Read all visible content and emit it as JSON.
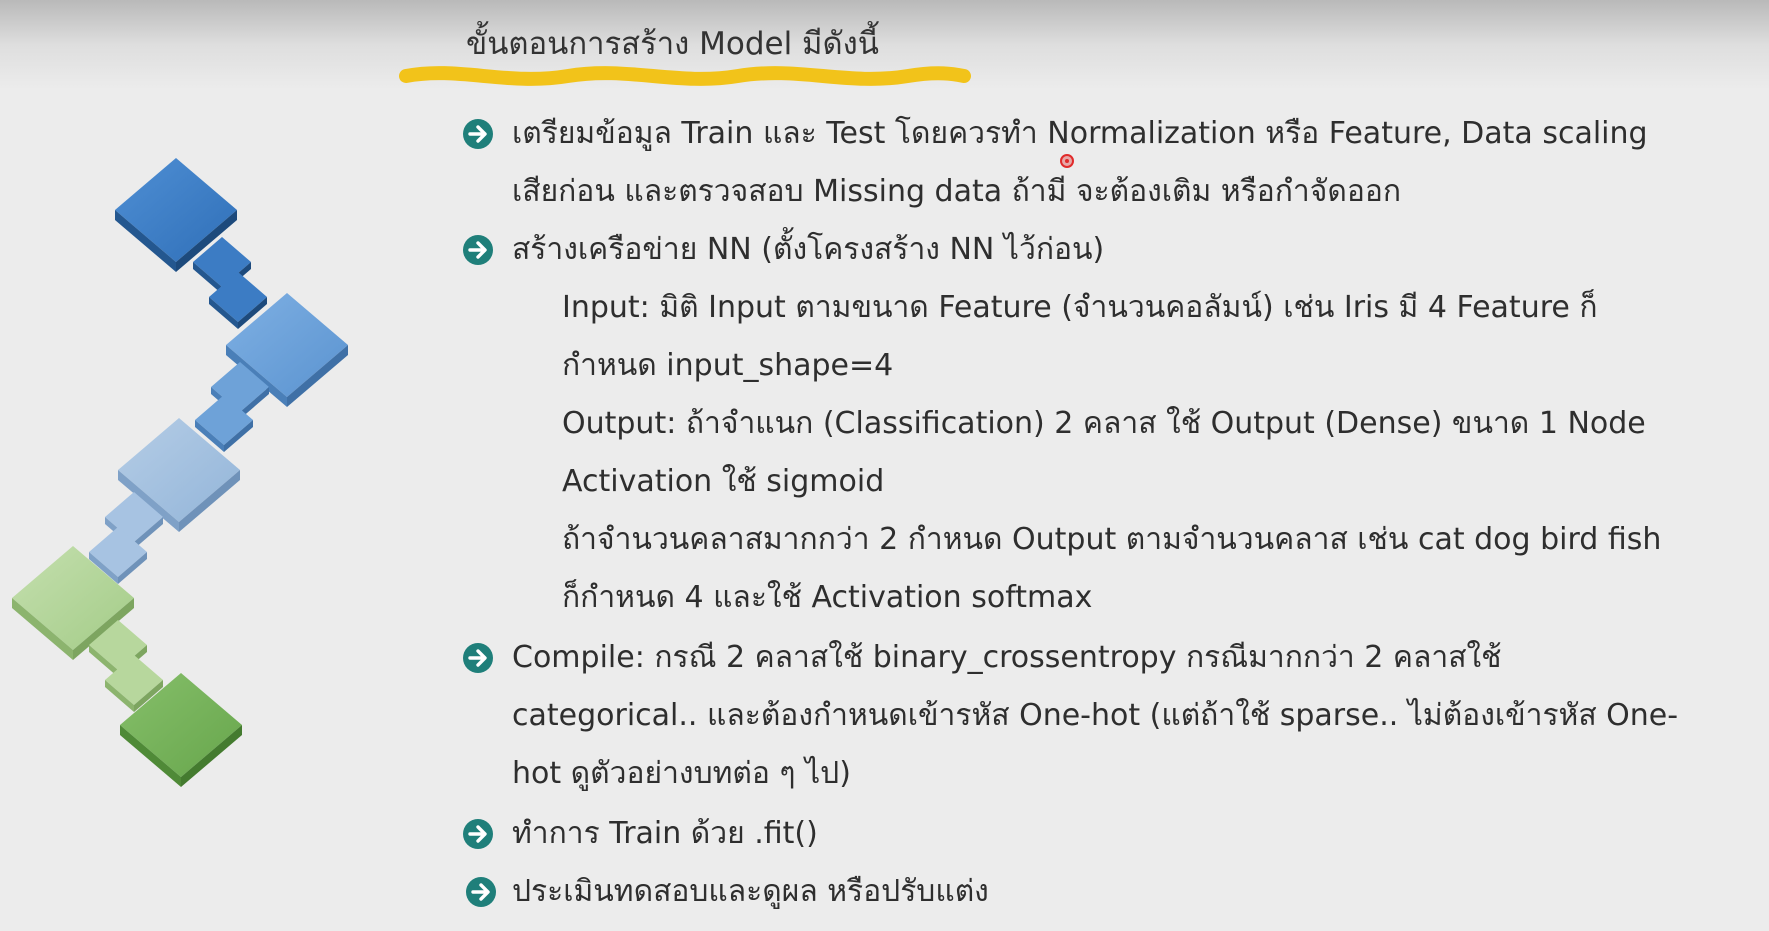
{
  "title": "ขั้นตอนการสร้าง Model มีดังนี้",
  "colors": {
    "underline": "#F2C31A",
    "bullet": "#1F7F7A",
    "cursor": "#E02B2B"
  },
  "icons": {
    "bullet": "arrow-right-circle-icon",
    "decoration": "diamond-chain-icon"
  },
  "items": [
    {
      "lines": [
        "เตรียมข้อมูล Train และ Test โดยควรทำ Normalization หรือ Feature, Data scaling",
        "เสียก่อน และตรวจสอบ Missing data ถ้ามี จะต้องเติม หรือกำจัดออก"
      ]
    },
    {
      "lines": [
        "สร้างเครือข่าย NN (ตั้งโครงสร้าง NN ไว้ก่อน)"
      ],
      "sub": [
        "Input: มิติ Input ตามขนาด Feature (จำนวนคอลัมน์) เช่น Iris มี 4 Feature ก็",
        "กำหนด input_shape=4",
        "Output: ถ้าจำแนก (Classification) 2 คลาส ใช้ Output (Dense) ขนาด 1 Node",
        "Activation ใช้ sigmoid",
        "ถ้าจำนวนคลาสมากกว่า 2 กำหนด Output ตามจำนวนคลาส เช่น cat dog bird fish",
        "ก็กำหนด 4 และใช้ Activation softmax"
      ]
    },
    {
      "lines": [
        "Compile: กรณี 2 คลาสใช้ binary_crossentropy กรณีมากกว่า 2 คลาสใช้",
        "categorical.. และต้องกำหนดเข้ารหัส One-hot (แต่ถ้าใช้ sparse.. ไม่ต้องเข้ารหัส One-",
        "hot ดูตัวอย่างบทต่อ ๆ ไป)"
      ]
    },
    {
      "lines": [
        "ทำการ Train ด้วย .fit()"
      ]
    },
    {
      "lines": [
        "ประเมินทดสอบและดูผล หรือปรับแต่ง"
      ]
    }
  ]
}
